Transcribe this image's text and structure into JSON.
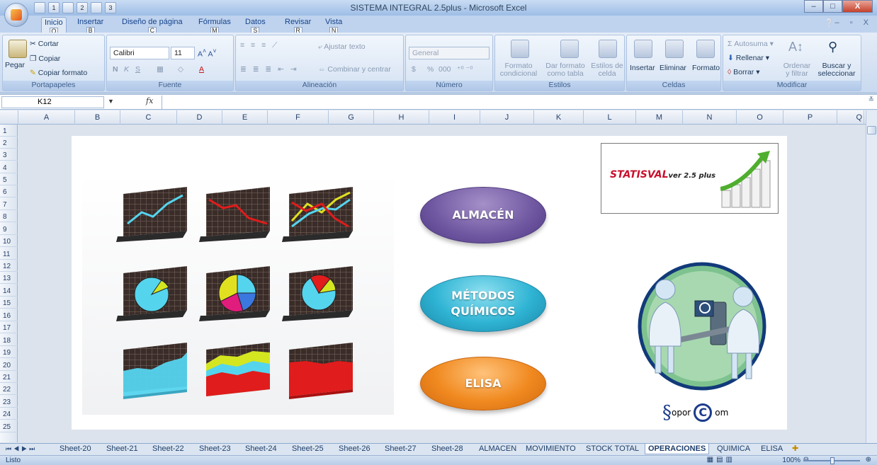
{
  "window": {
    "title": "SISTEMA INTEGRAL 2.5plus - Microsoft Excel",
    "minimize": "‒",
    "maximize": "□",
    "close": "X"
  },
  "qat": {
    "keys": [
      "1",
      "2",
      "3"
    ]
  },
  "ribbon_tabs": [
    {
      "label": "Inicio",
      "key": "O"
    },
    {
      "label": "Insertar",
      "key": "B"
    },
    {
      "label": "Diseño de página",
      "key": "C"
    },
    {
      "label": "Fórmulas",
      "key": "M"
    },
    {
      "label": "Datos",
      "key": "S"
    },
    {
      "label": "Revisar",
      "key": "R"
    },
    {
      "label": "Vista",
      "key": "N"
    }
  ],
  "ribbon_ctl": "– ▫ X",
  "clipboard": {
    "paste": "Pegar",
    "cut": "Cortar",
    "copy": "Copiar",
    "format_painter": "Copiar formato",
    "label": "Portapapeles"
  },
  "font": {
    "name": "Calibri",
    "size": "11",
    "bold": "N",
    "italic": "K",
    "underline": "S",
    "label": "Fuente"
  },
  "alignment": {
    "wrap": "Ajustar texto",
    "merge": "Combinar y centrar",
    "label": "Alineación"
  },
  "number": {
    "format": "General",
    "currency": "$",
    "percent": "%",
    "thousands": "000",
    "label": "Número"
  },
  "styles": {
    "conditional": "Formato condicional",
    "table": "Dar formato como tabla",
    "cell_styles": "Estilos de celda",
    "label": "Estilos"
  },
  "cells": {
    "insert": "Insertar",
    "delete": "Eliminar",
    "format": "Formato",
    "label": "Celdas"
  },
  "editing": {
    "autosum": "Autosuma",
    "fill": "Rellenar",
    "clear": "Borrar",
    "sort": "Ordenar y filtrar",
    "find": "Buscar y seleccionar",
    "label": "Modificar"
  },
  "formula_bar": {
    "name_box": "K12",
    "fx": "fx",
    "value": ""
  },
  "columns": [
    "A",
    "B",
    "C",
    "D",
    "E",
    "F",
    "G",
    "H",
    "I",
    "J",
    "K",
    "L",
    "M",
    "N",
    "O",
    "P",
    "Q"
  ],
  "rows": [
    "1",
    "2",
    "3",
    "4",
    "5",
    "6",
    "7",
    "8",
    "9",
    "10",
    "11",
    "12",
    "13",
    "14",
    "15",
    "16",
    "17",
    "18",
    "19",
    "20",
    "21",
    "22",
    "23",
    "24",
    "25"
  ],
  "buttons": {
    "almacen": "ALMACÉN",
    "metodos_line1": "MÉTODOS",
    "metodos_line2": "QUÍMICOS",
    "elisa": "ELISA"
  },
  "logo": {
    "name": "STATISVAL",
    "version": "ver 2.5 plus"
  },
  "brand": {
    "s": "§",
    "text1": "opor",
    "c": "C",
    "text2": "om"
  },
  "sheet_tabs": [
    "Sheet-20",
    "Sheet-21",
    "Sheet-22",
    "Sheet-23",
    "Sheet-24",
    "Sheet-25",
    "Sheet-26",
    "Sheet-27",
    "Sheet-28",
    "ALMACEN",
    "MOVIMIENTO",
    "STOCK TOTAL",
    "OPERACIONES",
    "QUIMICA",
    "ELISA"
  ],
  "active_sheet": "OPERACIONES",
  "status": {
    "text": "Listo",
    "zoom": "100%"
  },
  "colors": {
    "almacen": "#6e56a0",
    "metodos": "#2fb4d4",
    "elisa": "#f0891f",
    "logo_red": "#c8102e"
  }
}
